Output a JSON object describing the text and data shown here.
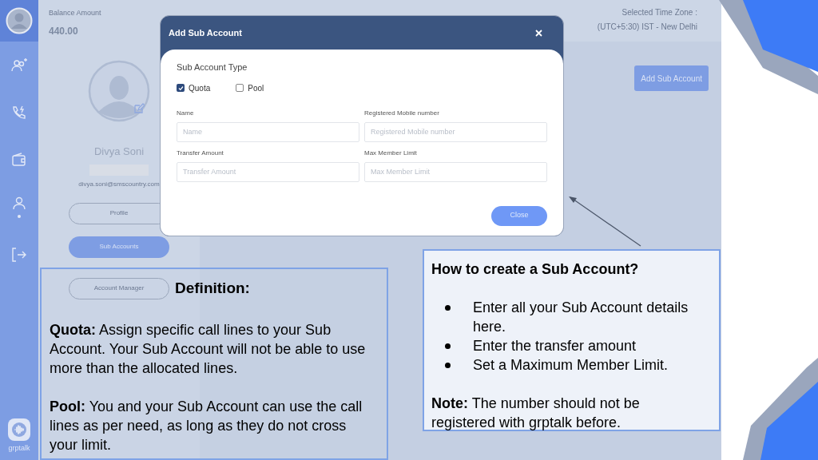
{
  "sidebar": {
    "items": [
      {
        "selected": false
      },
      {
        "selected": false
      },
      {
        "selected": false
      },
      {
        "selected": true
      },
      {
        "selected": false
      }
    ],
    "logo": "grptalk"
  },
  "header": {
    "balance_label": "Balance Amount",
    "balance_value": "440.00",
    "timezone_label": "Selected Time Zone :",
    "timezone_value": "(UTC+5:30) IST - New Delhi"
  },
  "profile": {
    "name": "Divya Soni",
    "email": "divya.soni@smscountry.com",
    "buttons": [
      {
        "label": "Profile",
        "selected": false
      },
      {
        "label": "Sub Accounts",
        "selected": true
      },
      {
        "label": "Account Manager",
        "selected": false
      }
    ]
  },
  "add_button": "Add Sub Account",
  "modal": {
    "title": "Add Sub Account",
    "type_label": "Sub Account Type",
    "options": [
      {
        "label": "Quota",
        "checked": true
      },
      {
        "label": "Pool",
        "checked": false
      }
    ],
    "fields": [
      {
        "label": "Name",
        "placeholder": "Name"
      },
      {
        "label": "Registered Mobile number",
        "placeholder": "Registered Mobile number"
      },
      {
        "label": "Transfer Amount",
        "placeholder": "Transfer Amount"
      },
      {
        "label": "Max Member Limit",
        "placeholder": "Max Member Limit"
      }
    ],
    "close_button": "Close"
  },
  "definition": {
    "title": "Definition:",
    "paragraphs": [
      "**Quota:** Assign specific call lines to your Sub Account. Your Sub Account will not be able to use more than the allocated lines.",
      "**Pool:** You and your Sub Account can use the call lines as per need, as long as they do not cross your limit."
    ]
  },
  "howto": {
    "title": "How to create a Sub Account?",
    "bullets": [
      "Enter all your Sub Account details here.",
      "Enter the transfer amount",
      "Set a Maximum Member Limit."
    ],
    "note": "**Note:** The number should not be registered with grptalk before."
  }
}
